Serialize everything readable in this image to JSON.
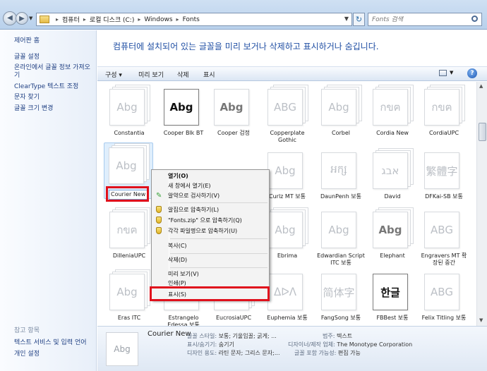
{
  "address": {
    "crumbs": [
      "컴퓨터",
      "로컬 디스크 (C:)",
      "Windows",
      "Fonts"
    ]
  },
  "search": {
    "placeholder": "Fonts 검색"
  },
  "sidebar": {
    "items": [
      "제어판 홈",
      "글꼴 설정",
      "온라인에서 글꼴 정보 가져오기",
      "ClearType 텍스트 조정",
      "문자 찾기",
      "글꼴 크기 변경"
    ],
    "see_also_title": "참고 항목",
    "see_also": [
      "텍스트 서비스 및 입력 언어",
      "개인 설정"
    ]
  },
  "header": {
    "title": "컴퓨터에 설치되어 있는 글꼴을 미리 보거나 삭제하고 표시하거나 숨깁니다."
  },
  "toolbar": {
    "organize": "구성 ▾",
    "preview": "미리 보기",
    "delete": "삭제",
    "show": "표시"
  },
  "fonts": [
    {
      "name": "Constantia",
      "sample": "Abg",
      "style": "light",
      "stack": true
    },
    {
      "name": "Cooper Blk BT",
      "sample": "Abg",
      "style": "dark",
      "stack": false
    },
    {
      "name": "Cooper 검정",
      "sample": "Abg",
      "style": "mid",
      "stack": false
    },
    {
      "name": "Copperplate Gothic",
      "sample": "ABG",
      "style": "light",
      "stack": true
    },
    {
      "name": "Corbel",
      "sample": "Abg",
      "style": "light",
      "stack": true
    },
    {
      "name": "Cordia New",
      "sample": "กขฅ",
      "style": "light",
      "stack": true
    },
    {
      "name": "CordiaUPC",
      "sample": "กขฅ",
      "style": "light",
      "stack": true
    },
    {
      "name": "Courier New",
      "sample": "Abg",
      "style": "light",
      "stack": true,
      "selected": true
    },
    {
      "name": "",
      "sample": "",
      "style": "light",
      "stack": true,
      "hidden": true
    },
    {
      "name": "",
      "sample": "Abg",
      "style": "dark",
      "stack": true,
      "hidden": true
    },
    {
      "name": "Curlz MT 보통",
      "sample": "Abg",
      "style": "light",
      "stack": false
    },
    {
      "name": "DaunPenh 보통",
      "sample": "អក្ស",
      "style": "light",
      "stack": false
    },
    {
      "name": "David",
      "sample": "אבג",
      "style": "light",
      "stack": true
    },
    {
      "name": "DFKai-SB 보통",
      "sample": "繁體字",
      "style": "light",
      "stack": false
    },
    {
      "name": "DilleniaUPC",
      "sample": "กขฅ",
      "style": "light",
      "stack": true
    },
    {
      "name": "",
      "sample": "",
      "style": "light",
      "stack": true,
      "hidden": true
    },
    {
      "name": "",
      "sample": "",
      "style": "light",
      "stack": true,
      "hidden": true
    },
    {
      "name": "Ebrima",
      "sample": "Abg",
      "style": "light",
      "stack": true
    },
    {
      "name": "Edwardian Script ITC 보통",
      "sample": "Abg",
      "style": "light",
      "stack": false
    },
    {
      "name": "Elephant",
      "sample": "Abg",
      "style": "mid",
      "stack": true
    },
    {
      "name": "Engravers MT 확장된 중간",
      "sample": "ABG",
      "style": "light",
      "stack": false
    },
    {
      "name": "Eras ITC",
      "sample": "Abg",
      "style": "light",
      "stack": true
    },
    {
      "name": "Estrangelo Edessa 보통",
      "sample": "",
      "style": "light",
      "stack": false
    },
    {
      "name": "EucrosiaUPC",
      "sample": "",
      "style": "light",
      "stack": true
    },
    {
      "name": "Euphemia 보통",
      "sample": "ᐃᐅᐱ",
      "style": "light",
      "stack": false
    },
    {
      "name": "FangSong 보통",
      "sample": "简体字",
      "style": "light",
      "stack": false
    },
    {
      "name": "FBBest 보통",
      "sample": "한글",
      "style": "dark",
      "stack": false
    },
    {
      "name": "Felix Titling 보통",
      "sample": "ABG",
      "style": "light",
      "stack": false
    }
  ],
  "context_menu": {
    "items": [
      "열기(O)",
      "새 창에서 열기(E)",
      "알약으로 검사하기(V)",
      "알집으로 압축하기(L)",
      "\"Fonts.zip\" 으로 압축하기(Q)",
      "각각 파일명으로 압축하기(U)",
      "복사(C)",
      "삭제(D)",
      "미리 보기(V)",
      "인쇄(P)",
      "표시(S)"
    ]
  },
  "details": {
    "name": "Courier New",
    "sample": "Abg",
    "style_label": "글꼴 스타일:",
    "style_value": "보통; 기울임꼴; 굵게; ...",
    "show_label": "표시/숨기기:",
    "show_value": "숨기기",
    "design_label": "디자인 용도:",
    "design_value": "라틴 문자; 그리스 문자;...",
    "cat_label": "범주:",
    "cat_value": "텍스트",
    "vendor_label": "디자이너/제작 업체:",
    "vendor_value": "The Monotype Corporation",
    "embed_label": "글꼴 포함 가능성:",
    "embed_value": "편집 가능"
  }
}
